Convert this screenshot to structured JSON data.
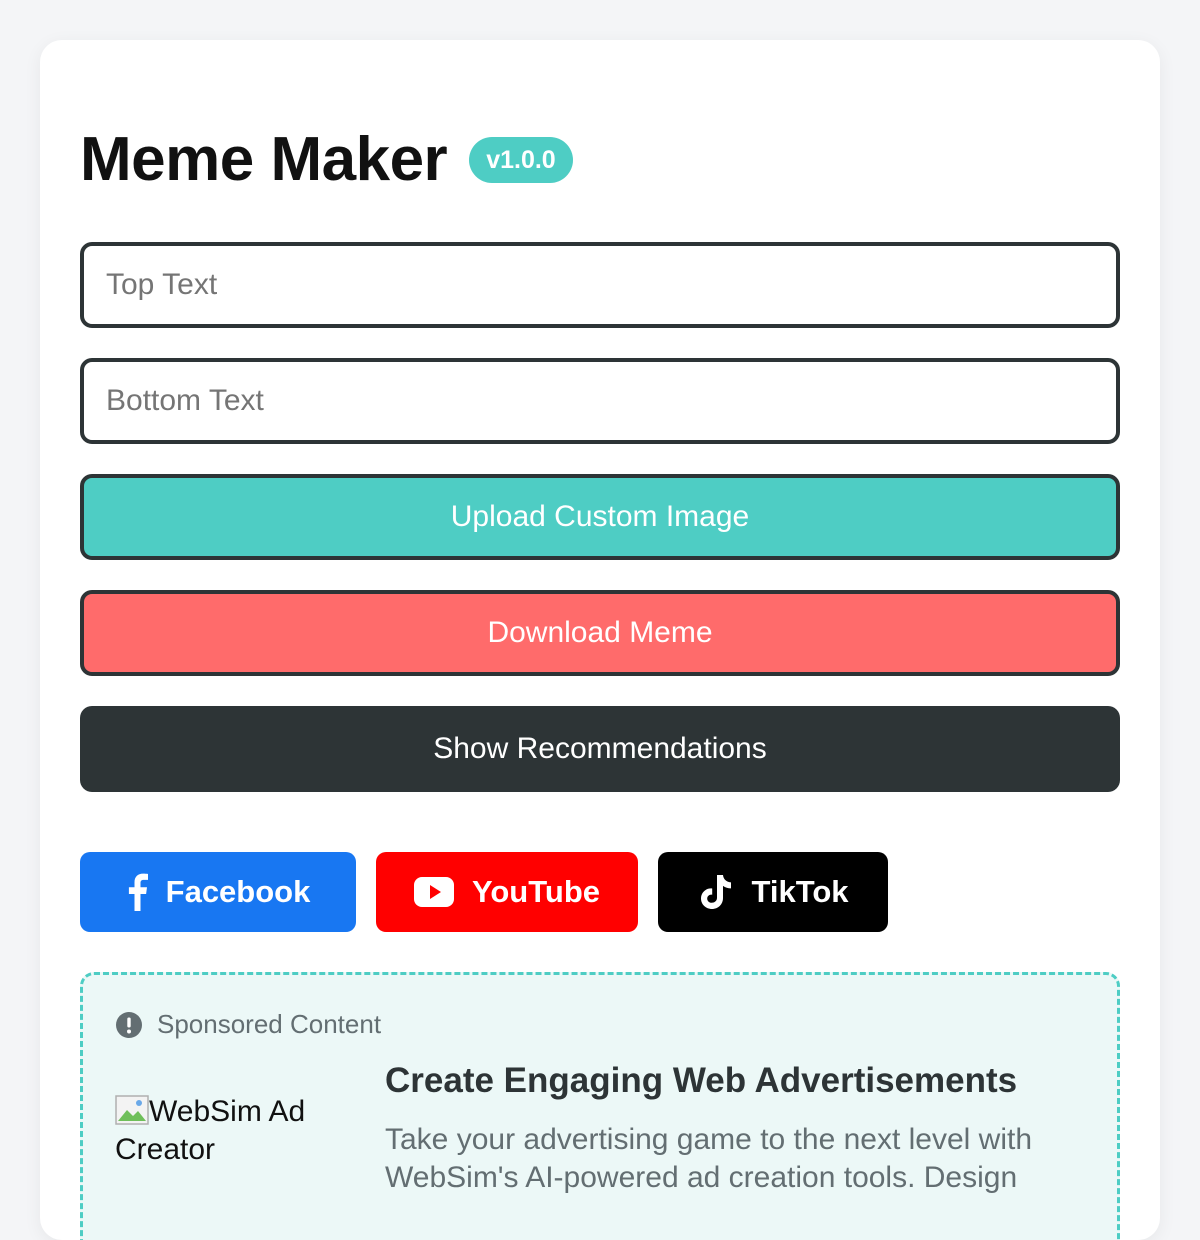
{
  "app": {
    "title": "Meme Maker",
    "version": "v1.0.0"
  },
  "inputs": {
    "top_placeholder": "Top Text",
    "top_value": "",
    "bottom_placeholder": "Bottom Text",
    "bottom_value": ""
  },
  "buttons": {
    "upload": "Upload Custom Image",
    "download": "Download Meme",
    "recommendations": "Show Recommendations"
  },
  "social": [
    {
      "label": "Facebook",
      "icon": "facebook-icon",
      "color": "#1877f2"
    },
    {
      "label": "YouTube",
      "icon": "youtube-icon",
      "color": "#ff0000"
    },
    {
      "label": "TikTok",
      "icon": "tiktok-icon",
      "color": "#000000"
    }
  ],
  "ad": {
    "label": "Sponsored Content",
    "label_icon": "exclamation-circle-icon",
    "image_alt": "WebSim Ad Creator",
    "title": "Create Engaging Web Advertisements",
    "description": "Take your advertising game to the next level with WebSim's AI-powered ad creation tools. Design"
  },
  "colors": {
    "accent": "#4ecdc4",
    "danger": "#ff6b6b",
    "dark": "#2d3436"
  }
}
